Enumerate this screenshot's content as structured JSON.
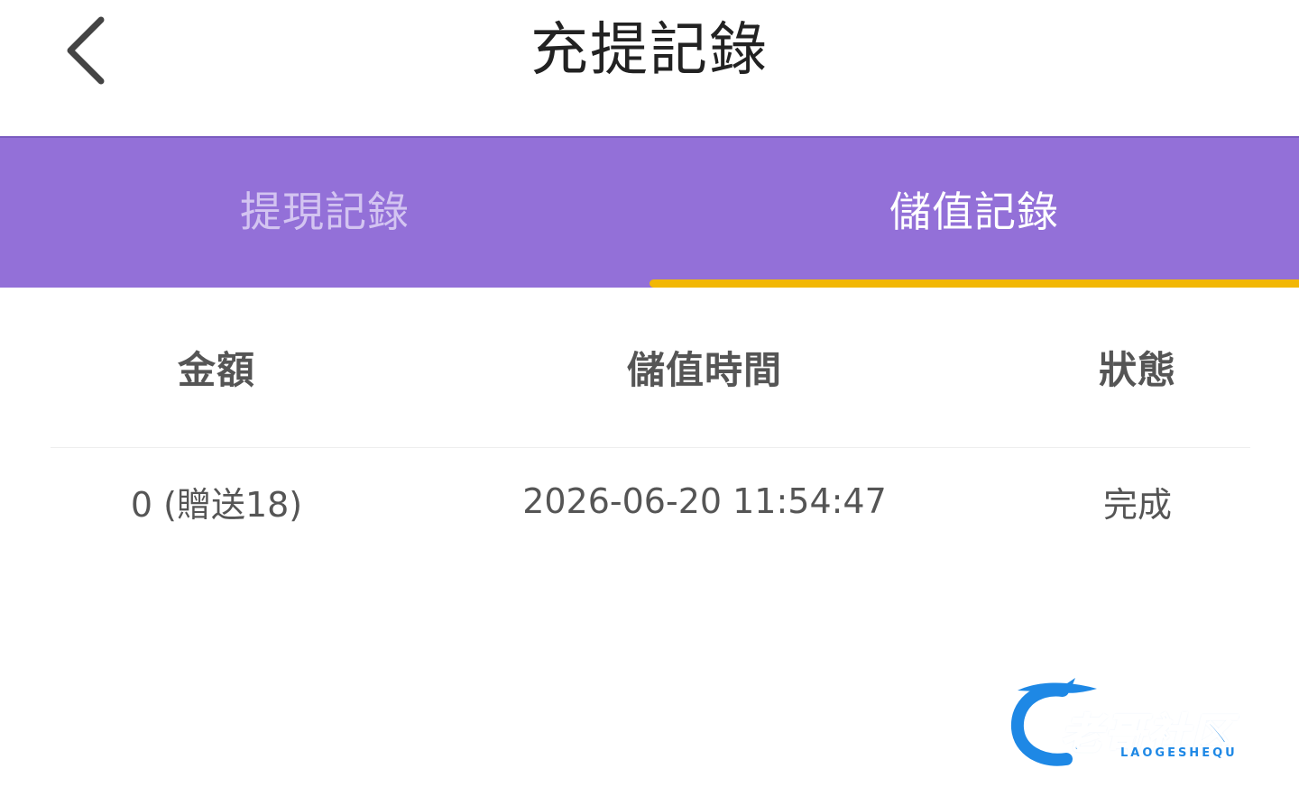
{
  "header": {
    "title": "充提記錄"
  },
  "tabs": [
    {
      "label": "提現記錄",
      "active": false
    },
    {
      "label": "儲值記錄",
      "active": true
    }
  ],
  "table": {
    "columns": [
      "金額",
      "儲值時間",
      "狀態"
    ],
    "rows": [
      {
        "amount": "0 (贈送18)",
        "time": "2026-06-20 11:54:47",
        "status": "完成"
      }
    ]
  },
  "watermark": {
    "text": "老哥社区",
    "subtext": "LAOGESHEQU"
  },
  "colors": {
    "tab_bar": "#9370d8",
    "tab_indicator": "#f2b705",
    "watermark_blue": "#1e88e5"
  },
  "icons": {
    "back": "chevron-left-icon",
    "logo": "dragon-logo-icon"
  }
}
